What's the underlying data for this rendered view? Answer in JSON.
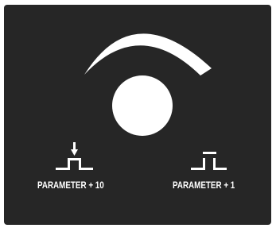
{
  "controls": {
    "knob": {
      "icon": "rotary-knob-icon",
      "arc_icon": "rotation-arc-icon"
    },
    "parameter_plus_10": {
      "label": "PARAMETER + 10",
      "icon": "press-pulse-icon"
    },
    "parameter_plus_1": {
      "label": "PARAMETER + 1",
      "icon": "pulse-icon"
    }
  },
  "colors": {
    "panel": "#262626",
    "foreground": "#ffffff",
    "page": "#ffffff"
  }
}
